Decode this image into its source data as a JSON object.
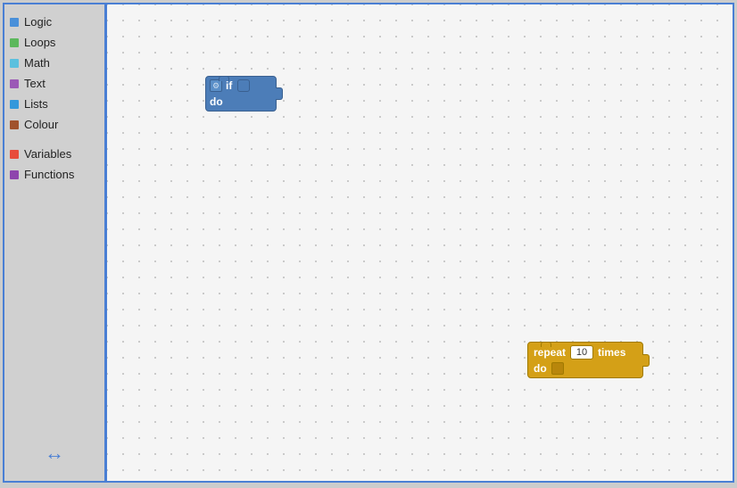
{
  "sidebar": {
    "items": [
      {
        "id": "logic",
        "label": "Logic",
        "color": "#4a90d9"
      },
      {
        "id": "loops",
        "label": "Loops",
        "color": "#5cb85c"
      },
      {
        "id": "math",
        "label": "Math",
        "color": "#5bc0de"
      },
      {
        "id": "text",
        "label": "Text",
        "color": "#9b59b6"
      },
      {
        "id": "lists",
        "label": "Lists",
        "color": "#3498db"
      },
      {
        "id": "colour",
        "label": "Colour",
        "color": "#a0522d"
      }
    ],
    "items2": [
      {
        "id": "variables",
        "label": "Variables",
        "color": "#e74c3c"
      },
      {
        "id": "functions",
        "label": "Functions",
        "color": "#8e44ad"
      }
    ]
  },
  "blocks": {
    "if_block": {
      "if_label": "if",
      "do_label": "do",
      "gear_symbol": "⚙"
    },
    "repeat_block": {
      "repeat_label": "repeat",
      "value": "10",
      "times_label": "times",
      "do_label": "do"
    }
  },
  "canvas": {
    "arrow_symbol": "↔"
  }
}
